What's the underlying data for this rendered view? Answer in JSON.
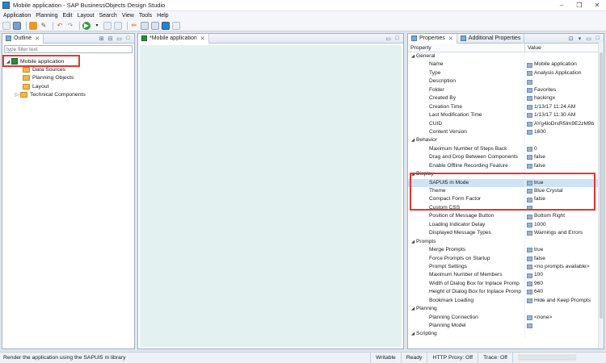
{
  "window": {
    "title": "Mobile application - SAP BusinessObjects Design Studio",
    "controls": [
      "–",
      "❐",
      "✕"
    ]
  },
  "menu": [
    "Application",
    "Planning",
    "Edit",
    "Layout",
    "Search",
    "View",
    "Tools",
    "Help"
  ],
  "outline": {
    "tab_label": "Outline",
    "filter_placeholder": "type filter text",
    "tree": {
      "root": "Mobile application",
      "children": [
        "Data Sources",
        "Planning Objects",
        "Layout",
        "Technical Components"
      ]
    }
  },
  "editor": {
    "tab_label": "*Mobile application"
  },
  "properties": {
    "tabs": [
      "Properties",
      "Additional Properties"
    ],
    "col_property": "Property",
    "col_value": "Value",
    "rows": [
      {
        "k": "General",
        "cat": true
      },
      {
        "k": "Name",
        "v": "Mobile application"
      },
      {
        "k": "Type",
        "v": "Analysis Application"
      },
      {
        "k": "Description",
        "v": ""
      },
      {
        "k": "Folder",
        "v": "Favorites"
      },
      {
        "k": "Created By",
        "v": "hackingx"
      },
      {
        "k": "Creation Time",
        "v": "1/13/17 11:24 AM"
      },
      {
        "k": "Last Modification Time",
        "v": "1/13/17 11:30 AM"
      },
      {
        "k": "CUID",
        "v": "AYg4loDrxR5lm9E2zM9b"
      },
      {
        "k": "Content Version",
        "v": "1600"
      },
      {
        "k": "Behavior",
        "cat": true
      },
      {
        "k": "Maximum Number of Steps Back",
        "v": "0"
      },
      {
        "k": "Drag and Drop Between Components",
        "v": "false"
      },
      {
        "k": "Enable Offline Recording Feature",
        "v": "false"
      },
      {
        "k": "Display",
        "cat": true
      },
      {
        "k": "SAPUI5 m Mode",
        "v": "true"
      },
      {
        "k": "Theme",
        "v": "Blue Crystal"
      },
      {
        "k": "Compact Form Factor",
        "v": "false"
      },
      {
        "k": "Custom CSS",
        "v": ""
      },
      {
        "k": "Position of Message Button",
        "v": "Bottom Right"
      },
      {
        "k": "Loading Indicator Delay",
        "v": "1000"
      },
      {
        "k": "Displayed Message Types",
        "v": "Warnings and Errors"
      },
      {
        "k": "Prompts",
        "cat": true
      },
      {
        "k": "Merge Prompts",
        "v": "true"
      },
      {
        "k": "Force Prompts on Startup",
        "v": "false"
      },
      {
        "k": "Prompt Settings",
        "v": "<no prompts available>"
      },
      {
        "k": "Maximum Number of Members",
        "v": "100"
      },
      {
        "k": "Width of Dialog Box for Inplace Promp",
        "v": "960"
      },
      {
        "k": "Height of Dialog Box for Inplace Promp",
        "v": "640"
      },
      {
        "k": "Bookmark Loading",
        "v": "Hide and Keep Prompts"
      },
      {
        "k": "Planning",
        "cat": true
      },
      {
        "k": "Planning Connection",
        "v": "<none>"
      },
      {
        "k": "Planning Model",
        "v": ""
      },
      {
        "k": "Scripting",
        "cat": true
      }
    ]
  },
  "statusbar": {
    "message": "Render the application using the SAPUI5 m library",
    "writable": "Writable",
    "ready": "Ready",
    "proxy": "HTTP Proxy: Off",
    "trace": "Trace: Off"
  },
  "colors": {
    "highlight": "#e8352a",
    "selection": "#cfe3f7",
    "canvas": "#e4f1f1"
  }
}
